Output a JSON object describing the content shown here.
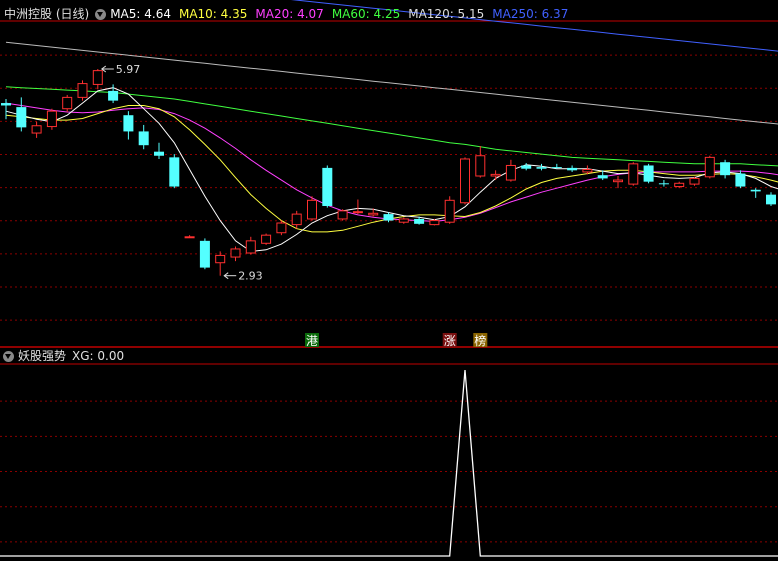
{
  "header": {
    "stock_title": "中洲控股 (日线)",
    "ma": [
      {
        "label": "MA5: 4.64",
        "color": "#ffffff"
      },
      {
        "label": "MA10: 4.35",
        "color": "#ffff40"
      },
      {
        "label": "MA20: 4.07",
        "color": "#ff40ff"
      },
      {
        "label": "MA60: 4.25",
        "color": "#40ff40"
      },
      {
        "label": "MA120: 5.15",
        "color": "#dddddd"
      },
      {
        "label": "MA250: 6.37",
        "color": "#4060ff"
      }
    ]
  },
  "indicator": {
    "title": "妖股强势",
    "xg_label": "XG: 0.00"
  },
  "markers": [
    {
      "text": "港",
      "bg": "#0a6a0a",
      "fg": "#ffffff",
      "candle": 20
    },
    {
      "text": "涨",
      "bg": "#7a1010",
      "fg": "#ffffff",
      "candle": 29
    },
    {
      "text": "榜",
      "bg": "#8a6400",
      "fg": "#ffffff",
      "candle": 31
    }
  ],
  "colors": {
    "up": "#ff3030",
    "down": "#54ffff",
    "grid": "#8b0000",
    "axis": "#c00000"
  },
  "chart_data": {
    "type": "candlestick",
    "yrange": [
      2.75,
      6.55
    ],
    "max_label": "5.97",
    "min_label": "2.93",
    "candles": [
      [
        5.55,
        5.6,
        5.35,
        5.52
      ],
      [
        5.5,
        5.62,
        5.2,
        5.25
      ],
      [
        5.18,
        5.32,
        5.12,
        5.27
      ],
      [
        5.26,
        5.48,
        5.22,
        5.45
      ],
      [
        5.48,
        5.65,
        5.44,
        5.62
      ],
      [
        5.62,
        5.83,
        5.58,
        5.79
      ],
      [
        5.78,
        5.97,
        5.72,
        5.95
      ],
      [
        5.7,
        5.78,
        5.55,
        5.58
      ],
      [
        5.4,
        5.45,
        5.1,
        5.2
      ],
      [
        5.2,
        5.28,
        4.98,
        5.03
      ],
      [
        4.95,
        5.06,
        4.86,
        4.9
      ],
      [
        4.88,
        4.92,
        4.5,
        4.52
      ],
      [
        3.9,
        3.92,
        3.89,
        3.9
      ],
      [
        3.85,
        3.88,
        3.5,
        3.52
      ],
      [
        3.58,
        3.72,
        3.42,
        3.67
      ],
      [
        3.65,
        3.78,
        3.6,
        3.75
      ],
      [
        3.7,
        3.9,
        3.68,
        3.85
      ],
      [
        3.82,
        3.94,
        3.8,
        3.92
      ],
      [
        3.95,
        4.1,
        3.92,
        4.07
      ],
      [
        4.05,
        4.22,
        4.0,
        4.18
      ],
      [
        4.12,
        4.4,
        4.1,
        4.35
      ],
      [
        4.75,
        4.78,
        4.26,
        4.28
      ],
      [
        4.12,
        4.24,
        4.1,
        4.22
      ],
      [
        4.2,
        4.36,
        4.18,
        4.21
      ],
      [
        4.17,
        4.25,
        4.15,
        4.19
      ],
      [
        4.18,
        4.2,
        4.08,
        4.1
      ],
      [
        4.08,
        4.14,
        4.06,
        4.12
      ],
      [
        4.12,
        4.15,
        4.05,
        4.06
      ],
      [
        4.05,
        4.12,
        4.04,
        4.1
      ],
      [
        4.08,
        4.4,
        4.06,
        4.35
      ],
      [
        4.32,
        4.88,
        4.3,
        4.86
      ],
      [
        4.65,
        5.02,
        4.63,
        4.9
      ],
      [
        4.65,
        4.72,
        4.6,
        4.67
      ],
      [
        4.6,
        4.85,
        4.58,
        4.78
      ],
      [
        4.78,
        4.81,
        4.72,
        4.74
      ],
      [
        4.76,
        4.8,
        4.72,
        4.74
      ],
      [
        4.76,
        4.8,
        4.74,
        4.75
      ],
      [
        4.75,
        4.78,
        4.7,
        4.72
      ],
      [
        4.7,
        4.78,
        4.67,
        4.73
      ],
      [
        4.66,
        4.72,
        4.6,
        4.62
      ],
      [
        4.58,
        4.65,
        4.5,
        4.6
      ],
      [
        4.55,
        4.82,
        4.53,
        4.8
      ],
      [
        4.78,
        4.8,
        4.56,
        4.58
      ],
      [
        4.56,
        4.6,
        4.52,
        4.55
      ],
      [
        4.52,
        4.58,
        4.5,
        4.56
      ],
      [
        4.55,
        4.64,
        4.53,
        4.62
      ],
      [
        4.64,
        4.9,
        4.62,
        4.88
      ],
      [
        4.82,
        4.85,
        4.62,
        4.66
      ],
      [
        4.68,
        4.72,
        4.5,
        4.52
      ],
      [
        4.48,
        4.5,
        4.38,
        4.46
      ],
      [
        4.42,
        4.45,
        4.28,
        4.3
      ],
      [
        4.28,
        4.35,
        4.25,
        4.26
      ],
      [
        4.22,
        4.24,
        4.1,
        4.12
      ]
    ],
    "ma5": [
      5.45,
      5.4,
      5.35,
      5.32,
      5.4,
      5.55,
      5.7,
      5.74,
      5.66,
      5.48,
      5.3,
      5.06,
      4.73,
      4.4,
      4.1,
      3.85,
      3.72,
      3.74,
      3.81,
      3.93,
      4.07,
      4.16,
      4.22,
      4.25,
      4.24,
      4.2,
      4.16,
      4.14,
      4.11,
      4.15,
      4.27,
      4.45,
      4.62,
      4.72,
      4.79,
      4.77,
      4.74,
      4.74,
      4.74,
      4.71,
      4.68,
      4.69,
      4.66,
      4.63,
      4.62,
      4.63,
      4.69,
      4.7,
      4.68,
      4.62,
      4.52,
      4.46,
      4.43
    ],
    "ma10": [
      5.4,
      5.38,
      5.36,
      5.34,
      5.34,
      5.36,
      5.42,
      5.48,
      5.52,
      5.52,
      5.48,
      5.38,
      5.22,
      5.04,
      4.85,
      4.63,
      4.42,
      4.25,
      4.1,
      4.0,
      3.96,
      3.96,
      3.98,
      4.03,
      4.08,
      4.12,
      4.15,
      4.17,
      4.17,
      4.16,
      4.15,
      4.2,
      4.28,
      4.38,
      4.49,
      4.57,
      4.62,
      4.65,
      4.68,
      4.71,
      4.72,
      4.72,
      4.7,
      4.68,
      4.66,
      4.66,
      4.67,
      4.68,
      4.67,
      4.64,
      4.6,
      4.55,
      4.5
    ],
    "ma20": [
      5.55,
      5.52,
      5.49,
      5.46,
      5.44,
      5.43,
      5.44,
      5.46,
      5.48,
      5.49,
      5.47,
      5.42,
      5.34,
      5.24,
      5.12,
      4.99,
      4.85,
      4.72,
      4.6,
      4.48,
      4.38,
      4.29,
      4.22,
      4.17,
      4.14,
      4.12,
      4.11,
      4.1,
      4.09,
      4.11,
      4.14,
      4.19,
      4.26,
      4.33,
      4.39,
      4.45,
      4.5,
      4.55,
      4.6,
      4.64,
      4.67,
      4.69,
      4.7,
      4.7,
      4.7,
      4.7,
      4.71,
      4.71,
      4.71,
      4.7,
      4.68,
      4.65,
      4.63
    ],
    "ma60": [
      5.75,
      5.74,
      5.73,
      5.72,
      5.71,
      5.7,
      5.69,
      5.68,
      5.66,
      5.64,
      5.62,
      5.6,
      5.57,
      5.54,
      5.51,
      5.48,
      5.45,
      5.42,
      5.39,
      5.36,
      5.33,
      5.3,
      5.27,
      5.24,
      5.21,
      5.18,
      5.15,
      5.12,
      5.09,
      5.06,
      5.04,
      5.01,
      4.98,
      4.96,
      4.94,
      4.92,
      4.9,
      4.88,
      4.87,
      4.86,
      4.85,
      4.84,
      4.83,
      4.82,
      4.81,
      4.8,
      4.8,
      4.8,
      4.8,
      4.79,
      4.78,
      4.77,
      4.76
    ],
    "ma120": [
      6.3,
      6.28,
      6.26,
      6.24,
      6.22,
      6.2,
      6.18,
      6.16,
      6.14,
      6.12,
      6.1,
      6.08,
      6.06,
      6.04,
      6.02,
      6.0,
      5.98,
      5.96,
      5.94,
      5.92,
      5.9,
      5.88,
      5.86,
      5.84,
      5.82,
      5.8,
      5.78,
      5.76,
      5.74,
      5.72,
      5.7,
      5.68,
      5.66,
      5.64,
      5.62,
      5.6,
      5.58,
      5.56,
      5.54,
      5.52,
      5.5,
      5.48,
      5.46,
      5.44,
      5.42,
      5.4,
      5.38,
      5.36,
      5.34,
      5.32,
      5.3,
      5.28,
      5.26
    ],
    "ma250": [
      7.2,
      7.18,
      7.16,
      7.14,
      7.12,
      7.1,
      7.08,
      7.06,
      7.04,
      7.02,
      7.0,
      6.98,
      6.96,
      6.94,
      6.92,
      6.9,
      6.88,
      6.86,
      6.84,
      6.82,
      6.8,
      6.78,
      6.76,
      6.74,
      6.72,
      6.7,
      6.68,
      6.66,
      6.64,
      6.62,
      6.6,
      6.58,
      6.56,
      6.54,
      6.52,
      6.5,
      6.48,
      6.46,
      6.44,
      6.42,
      6.4,
      6.38,
      6.36,
      6.34,
      6.32,
      6.3,
      6.28,
      6.26,
      6.24,
      6.22,
      6.2,
      6.18,
      6.16
    ],
    "xg": [
      0,
      0,
      0,
      0,
      0,
      0,
      0,
      0,
      0,
      0,
      0,
      0,
      0,
      0,
      0,
      0,
      0,
      0,
      0,
      0,
      0,
      0,
      0,
      0,
      0,
      0,
      0,
      0,
      0,
      0,
      1,
      0,
      0,
      0,
      0,
      0,
      0,
      0,
      0,
      0,
      0,
      0,
      0,
      0,
      0,
      0,
      0,
      0,
      0,
      0,
      0,
      0,
      0
    ]
  }
}
